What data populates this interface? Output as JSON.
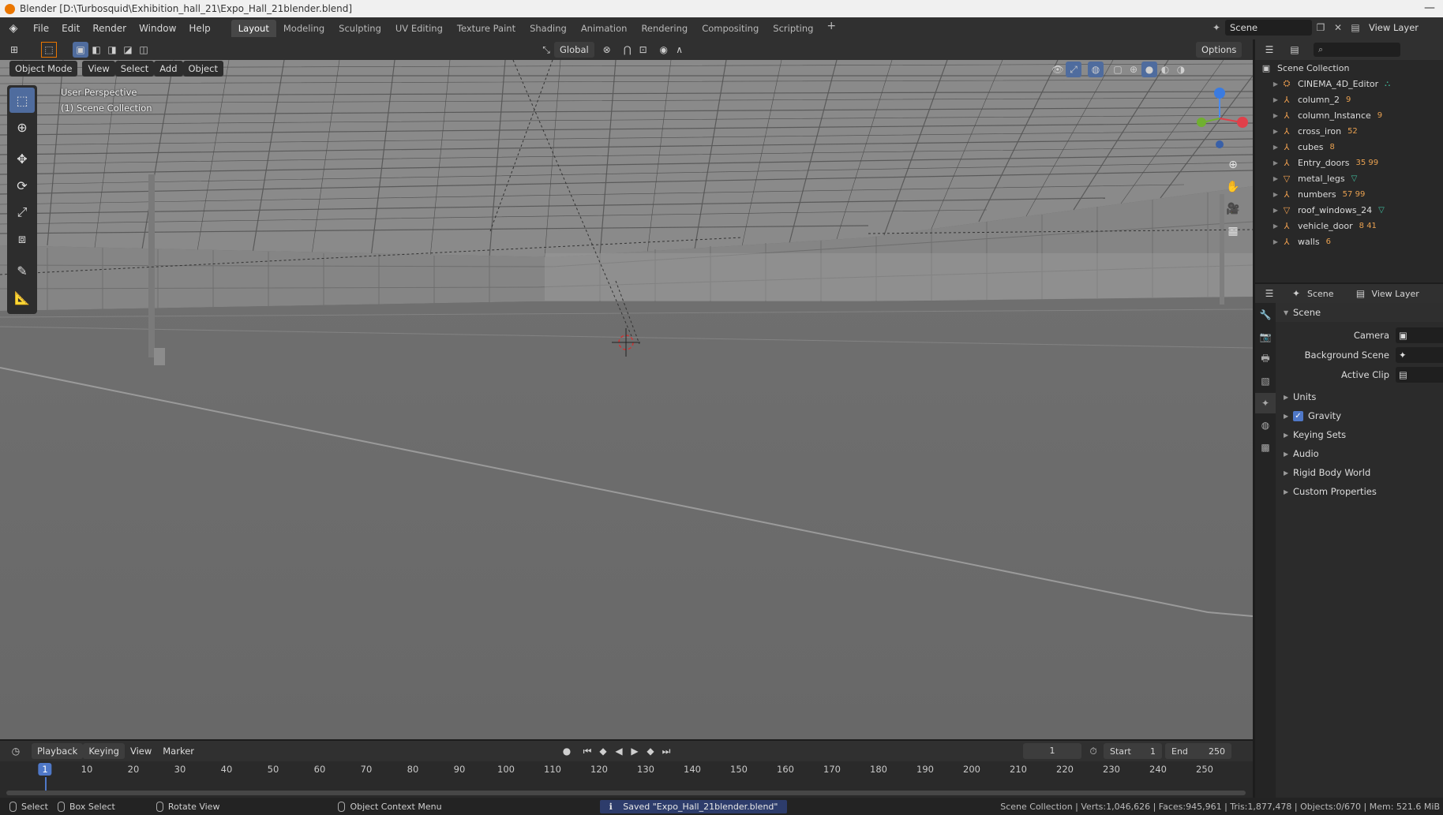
{
  "window": {
    "title": "Blender [D:\\Turbosquid\\Exhibition_hall_21\\Expo_Hall_21blender.blend]",
    "controls": "—"
  },
  "menu": {
    "items": [
      "File",
      "Edit",
      "Render",
      "Window",
      "Help"
    ]
  },
  "workspaces": {
    "tabs": [
      "Layout",
      "Modeling",
      "Sculpting",
      "UV Editing",
      "Texture Paint",
      "Shading",
      "Animation",
      "Rendering",
      "Compositing",
      "Scripting"
    ],
    "active": "Layout",
    "add": "+"
  },
  "scene_selector": {
    "scene": "Scene",
    "view_layer": "View Layer"
  },
  "viewport": {
    "mode": "Object Mode",
    "menus": [
      "View",
      "Select",
      "Add",
      "Object"
    ],
    "transform_orientation": "Global",
    "options_label": "Options",
    "overlay_line1": "User Perspective",
    "overlay_line2": "(1) Scene Collection"
  },
  "outliner": {
    "root": "Scene Collection",
    "items": [
      {
        "name": "CINEMA_4D_Editor",
        "badge": "",
        "icon": "empty"
      },
      {
        "name": "column_2",
        "badge": "9",
        "icon": "empty"
      },
      {
        "name": "column_Instance",
        "badge": "9",
        "icon": "empty"
      },
      {
        "name": "cross_iron",
        "badge": "52",
        "icon": "empty"
      },
      {
        "name": "cubes",
        "badge": "8",
        "icon": "empty"
      },
      {
        "name": "Entry_doors",
        "badge": "35 99",
        "icon": "empty"
      },
      {
        "name": "metal_legs",
        "badge": "",
        "icon": "mesh"
      },
      {
        "name": "numbers",
        "badge": "57 99",
        "icon": "empty"
      },
      {
        "name": "roof_windows_24",
        "badge": "",
        "icon": "mesh"
      },
      {
        "name": "vehicle_door",
        "badge": "8 41",
        "icon": "empty"
      },
      {
        "name": "walls",
        "badge": "6",
        "icon": "empty"
      }
    ]
  },
  "properties": {
    "header_scene": "Scene",
    "header_view_layer": "View Layer",
    "section": "Scene",
    "fields": [
      {
        "label": "Camera"
      },
      {
        "label": "Background Scene"
      },
      {
        "label": "Active Clip"
      }
    ],
    "panels": [
      "Units",
      "Gravity",
      "Keying Sets",
      "Audio",
      "Rigid Body World",
      "Custom Properties"
    ],
    "gravity_checked": true
  },
  "timeline": {
    "menus": [
      "Playback",
      "Keying",
      "View",
      "Marker"
    ],
    "current_frame": "1",
    "start_label": "Start",
    "start": "1",
    "end_label": "End",
    "end": "250",
    "ticks": [
      "10",
      "20",
      "30",
      "40",
      "50",
      "60",
      "70",
      "80",
      "90",
      "100",
      "110",
      "120",
      "130",
      "140",
      "150",
      "160",
      "170",
      "180",
      "190",
      "200",
      "210",
      "220",
      "230",
      "240",
      "250"
    ]
  },
  "status": {
    "select": "Select",
    "box_select": "Box Select",
    "rotate_view": "Rotate View",
    "context_menu": "Object Context Menu",
    "saved": "Saved \"Expo_Hall_21blender.blend\"",
    "stats": "Scene Collection | Verts:1,046,626 | Faces:945,961 | Tris:1,877,478 | Objects:0/670 | Mem: 521.6 MiB"
  }
}
